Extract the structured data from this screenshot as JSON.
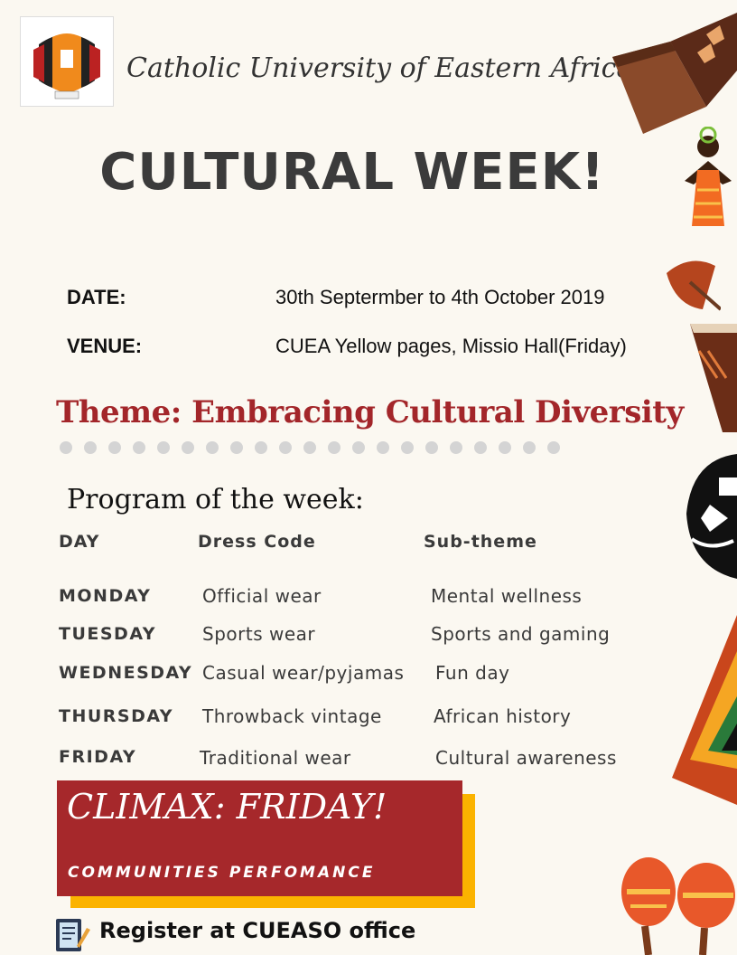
{
  "header": {
    "university": "Catholic University of Eastern Africa",
    "title": "CULTURAL WEEK!"
  },
  "info": {
    "date_label": "DATE:",
    "date_value": "30th Septermber to 4th October 2019",
    "venue_label": "VENUE:",
    "venue_value": "CUEA Yellow pages, Missio Hall(Friday)"
  },
  "theme": "Theme: Embracing Cultural Diversity",
  "program": {
    "heading": "Program of the week:",
    "columns": [
      "DAY",
      "Dress Code",
      "Sub-theme"
    ],
    "rows": [
      {
        "day": "MONDAY",
        "dress": "Official wear",
        "sub": "Mental wellness"
      },
      {
        "day": "TUESDAY",
        "dress": "Sports wear",
        "sub": "Sports and gaming"
      },
      {
        "day": "WEDNESDAY",
        "dress": "Casual wear/pyjamas",
        "sub": "Fun day"
      },
      {
        "day": "THURSDAY",
        "dress": "Throwback vintage",
        "sub": "African history"
      },
      {
        "day": "FRIDAY",
        "dress": "Traditional wear",
        "sub": "Cultural awareness"
      }
    ]
  },
  "climax": {
    "title": "CLIMAX: FRIDAY!",
    "subtitle": "COMMUNITIES PERFOMANCE"
  },
  "register": "Register at CUEASO office",
  "colors": {
    "background": "#fbf8f1",
    "theme_red": "#a3262a",
    "climax_red": "#a6282b",
    "climax_yellow": "#fbb300"
  }
}
